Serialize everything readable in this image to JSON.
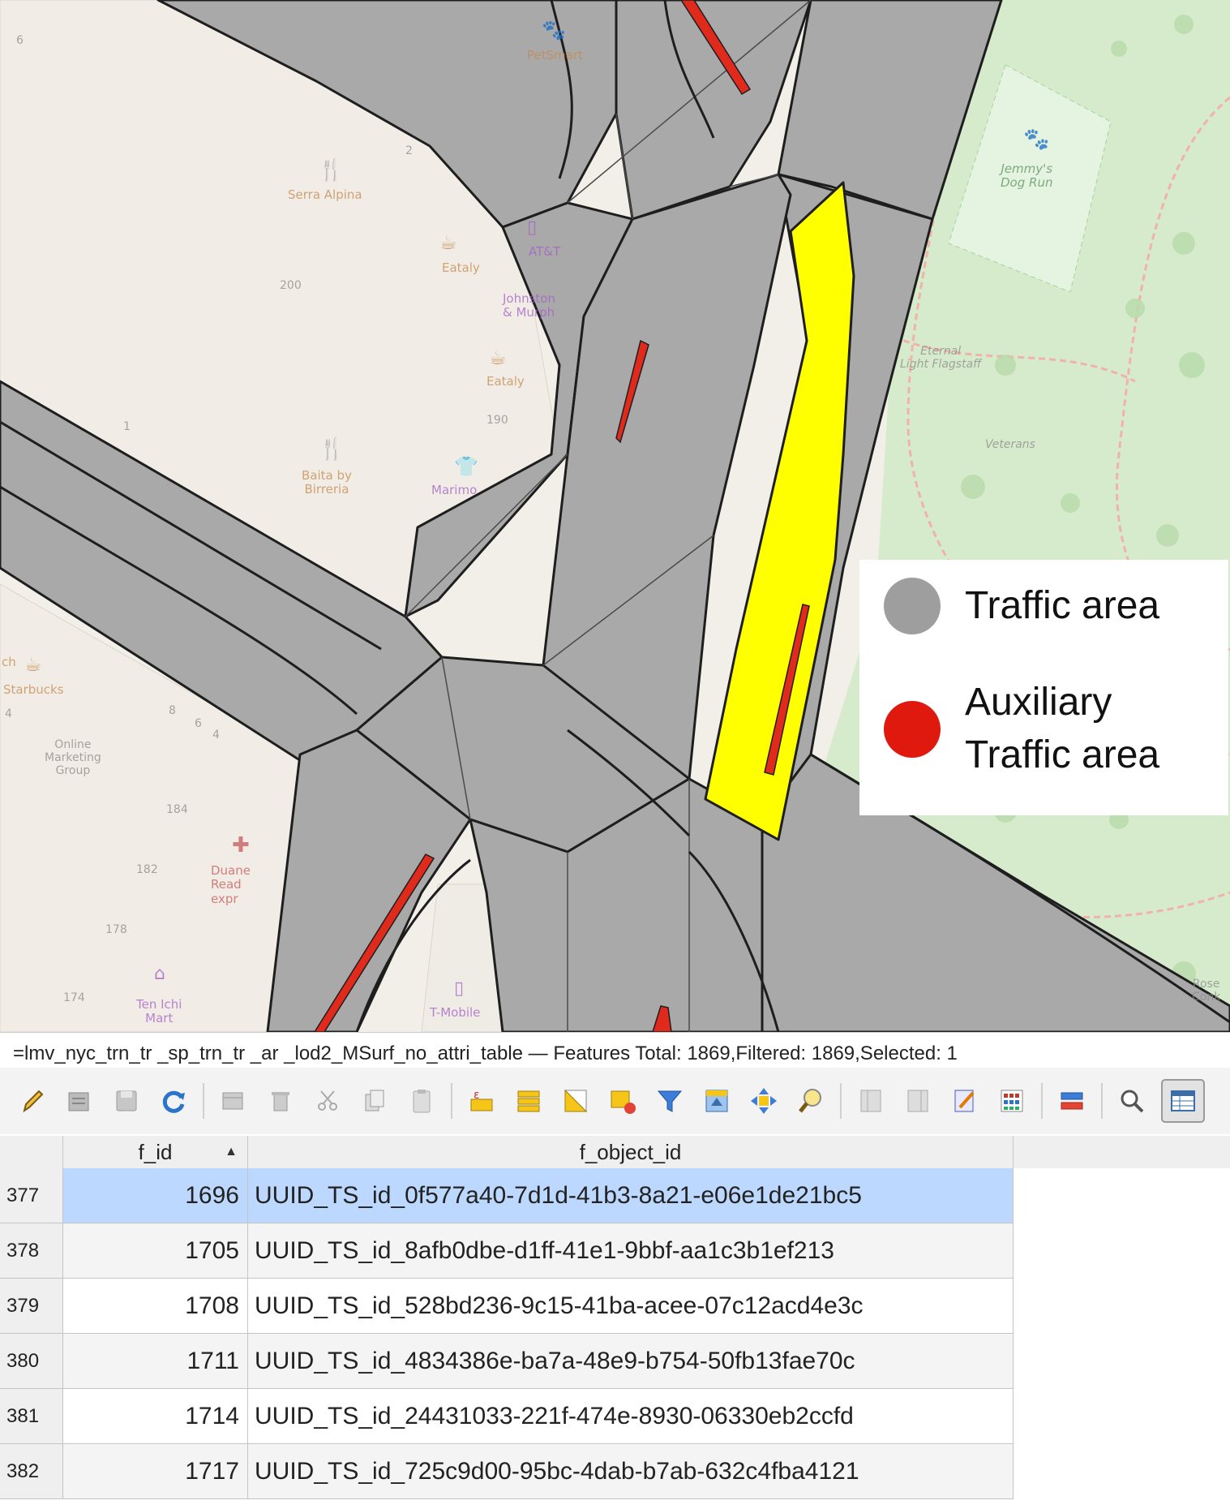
{
  "map": {
    "legend": {
      "items": [
        {
          "label": "Traffic area",
          "color": "#9e9e9e"
        },
        {
          "label": "Auxiliary\nTraffic area",
          "color": "#e0190f"
        }
      ]
    },
    "colors": {
      "traffic_area": "#a9a9a9",
      "auxiliary_traffic_area": "#df2a1c",
      "selected": "#ffff00",
      "park": "#d8ecd0",
      "building": "#f0ece4"
    },
    "basemap_labels": {
      "petsmart": "PetSmart",
      "serra_alpina": "Serra Alpina",
      "eataly_1": "Eataly",
      "att": "AT&T",
      "johnston": "Johnston\n& Murph",
      "eataly_2": "Eataly",
      "baita": "Baita by\nBirreria",
      "marimo": "Marimo",
      "starbucks": "Starbucks",
      "online_marketing": "Online\nMarketing\nGroup",
      "duane_reade": "Duane\nRead\nexpr",
      "t_mobile": "T-Mobile",
      "ten_ichi": "Ten Ichi\nMart",
      "jemmys": "Jemmy's\nDog Run",
      "eternal_light": "Eternal\nLight Flagstaff",
      "veterans": "Veterans",
      "rose_conk": "Rose\nConk",
      "num_200": "200",
      "num_190": "190",
      "num_1": "1",
      "num_2": "2",
      "num_6": "6",
      "num_184": "184",
      "num_182": "182",
      "num_178": "178",
      "num_174": "174",
      "num_8": "8",
      "num_6b": "6",
      "num_4": "4",
      "num_4b": "4",
      "num_ch": "ch"
    }
  },
  "attribute_table": {
    "status": "=lmv_nyc_trn_tr _sp_trn_tr _ar _lod2_MSurf_no_attri_table — Features Total: 1869,Filtered: 1869,Selected: 1",
    "toolbar_icons": [
      "edit-pencil-icon",
      "multi-edit-icon",
      "save-edits-icon",
      "reload-icon",
      "add-feature-icon",
      "delete-feature-icon",
      "cut-icon",
      "copy-icon",
      "paste-icon",
      "select-expression-icon",
      "select-all-icon",
      "invert-selection-icon",
      "deselect-all-icon",
      "filter-selected-icon",
      "move-selection-top-icon",
      "pan-to-selected-icon",
      "zoom-to-selected-icon",
      "new-field-icon",
      "delete-field-icon",
      "field-calculator-icon",
      "conditional-format-icon",
      "actions-icon",
      "dock-table-icon",
      "table-view-icon"
    ],
    "columns": [
      "f_id",
      "f_object_id"
    ],
    "sort_indicator": "▲",
    "rows": [
      {
        "index": "377",
        "f_id": "1696",
        "f_object_id": "UUID_TS_id_0f577a40-7d1d-41b3-8a21-e06e1de21bc5",
        "selected": true
      },
      {
        "index": "378",
        "f_id": "1705",
        "f_object_id": "UUID_TS_id_8afb0dbe-d1ff-41e1-9bbf-aa1c3b1ef213"
      },
      {
        "index": "379",
        "f_id": "1708",
        "f_object_id": "UUID_TS_id_528bd236-9c15-41ba-acee-07c12acd4e3c"
      },
      {
        "index": "380",
        "f_id": "1711",
        "f_object_id": "UUID_TS_id_4834386e-ba7a-48e9-b754-50fb13fae70c"
      },
      {
        "index": "381",
        "f_id": "1714",
        "f_object_id": "UUID_TS_id_24431033-221f-474e-8930-06330eb2ccfd"
      },
      {
        "index": "382",
        "f_id": "1717",
        "f_object_id": "UUID_TS_id_725c9d00-95bc-4dab-b7ab-632c4fba4121"
      }
    ]
  }
}
